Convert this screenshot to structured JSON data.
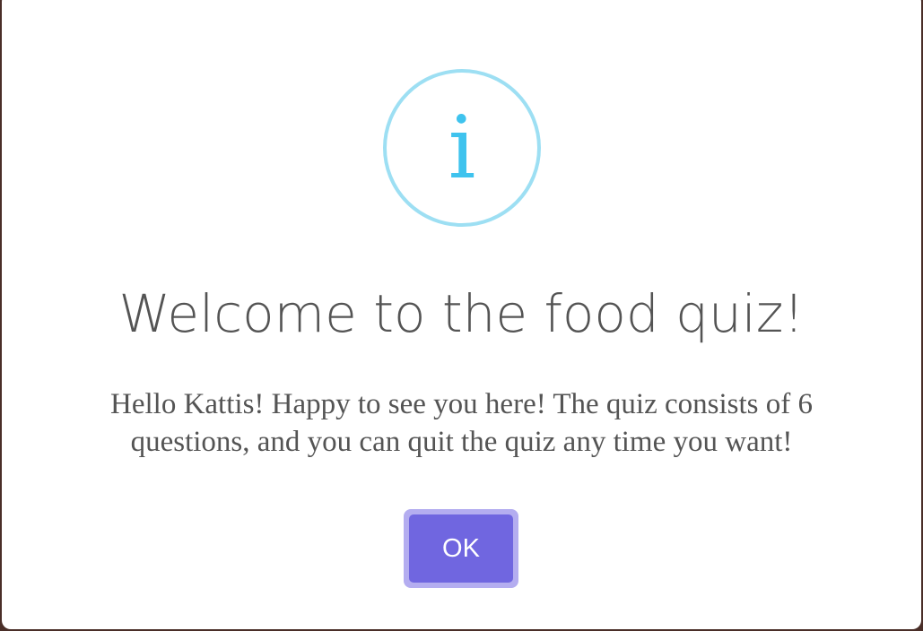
{
  "dialog": {
    "icon": "info-icon",
    "icon_glyph": "i",
    "icon_color": "#3fc3ee",
    "icon_ring_color": "#9ddff3",
    "title": "Welcome to the food quiz!",
    "message": "Hello Kattis! Happy to see you here! The quiz consists of 6 questions, and you can quit the quiz any time you want!",
    "confirm_label": "OK",
    "confirm_color": "#7066e0"
  }
}
